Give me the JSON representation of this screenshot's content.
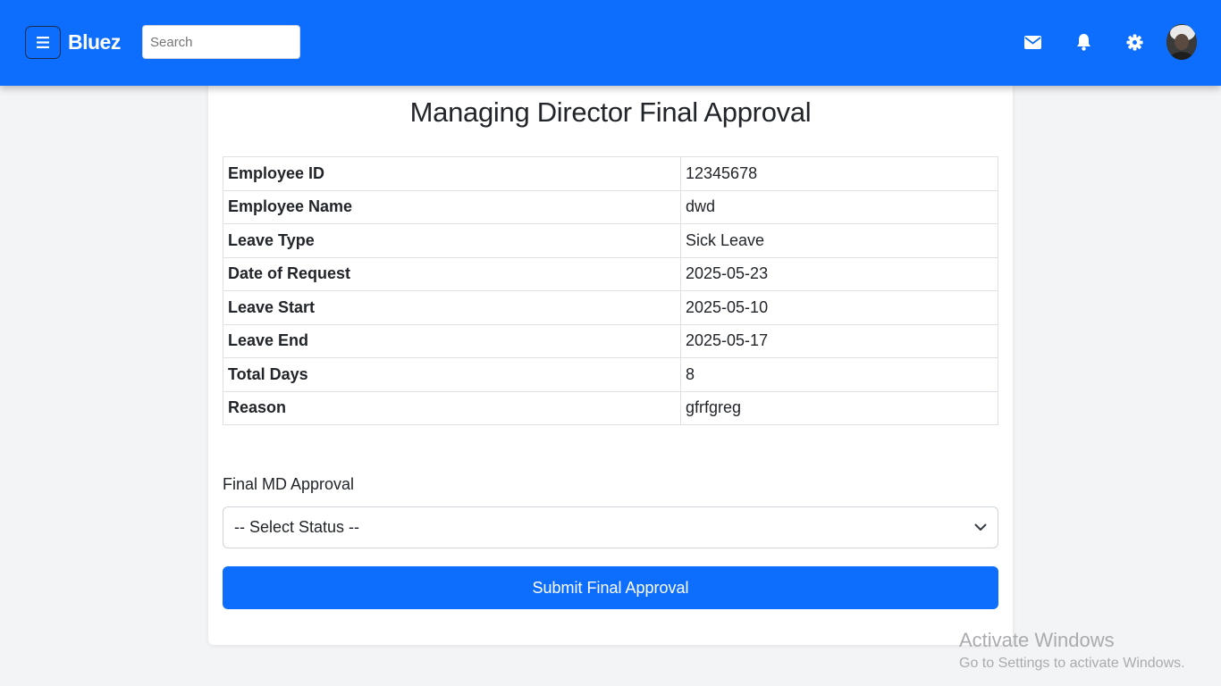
{
  "header": {
    "brand": "Bluez",
    "search_placeholder": "Search",
    "icons": [
      "menu-icon",
      "envelope-icon",
      "bell-icon",
      "gear-icon",
      "avatar"
    ],
    "background_color": "#0d6efd"
  },
  "page": {
    "title": "Managing Director Final Approval"
  },
  "details": [
    {
      "label": "Employee ID",
      "value": "12345678"
    },
    {
      "label": "Employee Name",
      "value": "dwd"
    },
    {
      "label": "Leave Type",
      "value": "Sick Leave"
    },
    {
      "label": "Date of Request",
      "value": "2025-05-23"
    },
    {
      "label": "Leave Start",
      "value": "2025-05-10"
    },
    {
      "label": "Leave End",
      "value": "2025-05-17"
    },
    {
      "label": "Total Days",
      "value": "8"
    },
    {
      "label": "Reason",
      "value": "gfrfgreg"
    }
  ],
  "form": {
    "approval_label": "Final MD Approval",
    "select_value": "-- Select Status --",
    "submit_label": "Submit Final Approval",
    "submit_color": "#0d6efd"
  },
  "watermark": {
    "title": "Activate Windows",
    "subtitle": "Go to Settings to activate Windows."
  }
}
